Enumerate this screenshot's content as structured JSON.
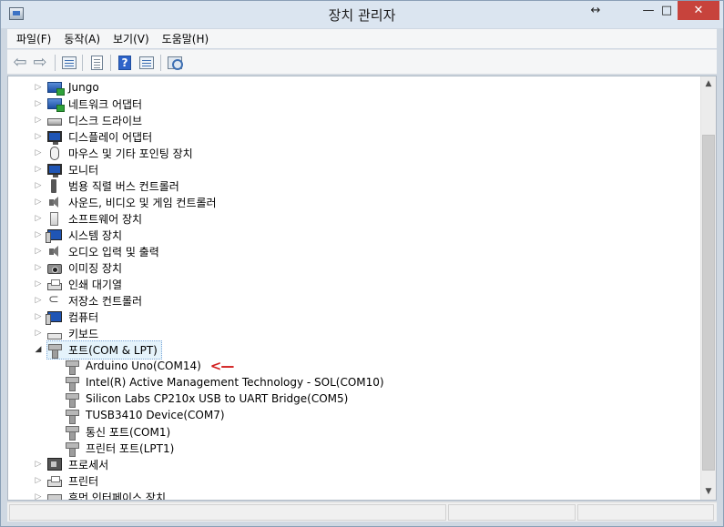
{
  "window": {
    "title": "장치 관리자",
    "controls": {
      "resize": "↔",
      "minimize": "—",
      "maximize": "□",
      "close": "✕"
    }
  },
  "menu": {
    "items": [
      {
        "label": "파일(F)"
      },
      {
        "label": "동작(A)"
      },
      {
        "label": "보기(V)"
      },
      {
        "label": "도움말(H)"
      }
    ]
  },
  "toolbar": {
    "back_icon": "back-arrow-icon",
    "forward_icon": "forward-arrow-icon",
    "buttons": [
      "show-hide-console-tree-icon",
      "properties-icon",
      "help-icon",
      "action-pane-icon",
      "scan-hardware-icon"
    ],
    "help_glyph": "?"
  },
  "tree": {
    "categories": [
      {
        "label": "Jungo",
        "icon": "network-icon",
        "expanded": false
      },
      {
        "label": "네트워크 어댑터",
        "icon": "network-adapter-icon",
        "expanded": false
      },
      {
        "label": "디스크 드라이브",
        "icon": "disk-drive-icon",
        "expanded": false
      },
      {
        "label": "디스플레이 어댑터",
        "icon": "display-adapter-icon",
        "expanded": false
      },
      {
        "label": "마우스 및 기타 포인팅 장치",
        "icon": "mouse-icon",
        "expanded": false
      },
      {
        "label": "모니터",
        "icon": "monitor-icon",
        "expanded": false
      },
      {
        "label": "범용 직렬 버스 컨트롤러",
        "icon": "usb-controller-icon",
        "expanded": false
      },
      {
        "label": "사운드, 비디오 및 게임 컨트롤러",
        "icon": "speaker-icon",
        "expanded": false
      },
      {
        "label": "소프트웨어 장치",
        "icon": "software-device-icon",
        "expanded": false
      },
      {
        "label": "시스템 장치",
        "icon": "system-device-icon",
        "expanded": false
      },
      {
        "label": "오디오 입력 및 출력",
        "icon": "audio-io-icon",
        "expanded": false
      },
      {
        "label": "이미징 장치",
        "icon": "imaging-device-icon",
        "expanded": false
      },
      {
        "label": "인쇄 대기열",
        "icon": "print-queue-icon",
        "expanded": false
      },
      {
        "label": "저장소 컨트롤러",
        "icon": "storage-controller-icon",
        "expanded": false
      },
      {
        "label": "컴퓨터",
        "icon": "computer-icon",
        "expanded": false
      },
      {
        "label": "키보드",
        "icon": "keyboard-icon",
        "expanded": false
      },
      {
        "label": "포트(COM & LPT)",
        "icon": "port-icon",
        "expanded": true,
        "selected": true
      }
    ],
    "ports_children": [
      {
        "label": "Arduino Uno(COM14)",
        "icon": "port-icon",
        "annotated": true
      },
      {
        "label": "Intel(R) Active Management Technology - SOL(COM10)",
        "icon": "port-icon"
      },
      {
        "label": "Silicon Labs CP210x USB to UART Bridge(COM5)",
        "icon": "port-icon"
      },
      {
        "label": "TUSB3410 Device(COM7)",
        "icon": "port-icon"
      },
      {
        "label": "통신 포트(COM1)",
        "icon": "port-icon"
      },
      {
        "label": "프린터 포트(LPT1)",
        "icon": "port-icon"
      }
    ],
    "after_categories": [
      {
        "label": "프로세서",
        "icon": "processor-icon",
        "expanded": false
      },
      {
        "label": "프린터",
        "icon": "printer-icon",
        "expanded": false
      },
      {
        "label": "휴먼 인터페이스 장치",
        "icon": "hid-icon",
        "expanded": false
      }
    ],
    "annotation_arrow": "<—",
    "expander_collapsed": "▷",
    "expander_expanded": "◢"
  },
  "scrollbar": {
    "up": "▲",
    "down": "▼"
  },
  "colors": {
    "selection_bg": "#e5f3fb",
    "close_button": "#c7433c",
    "annotation_arrow": "#d21f1f"
  }
}
